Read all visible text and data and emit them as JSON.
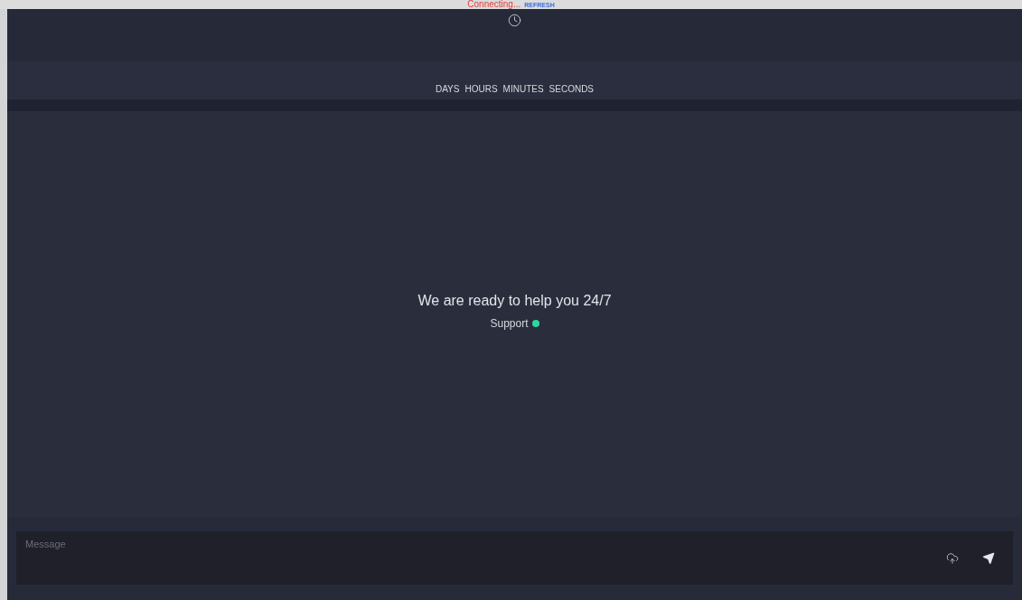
{
  "connection_bar": {
    "status": "Connecting...",
    "action": "REFRESH"
  },
  "countdown": {
    "units": [
      "DAYS",
      "HOURS",
      "MINUTES",
      "SECONDS"
    ]
  },
  "welcome": {
    "headline": "We are ready to help you 24/7",
    "agent": "Support",
    "online": true
  },
  "composer": {
    "placeholder": "Message"
  }
}
